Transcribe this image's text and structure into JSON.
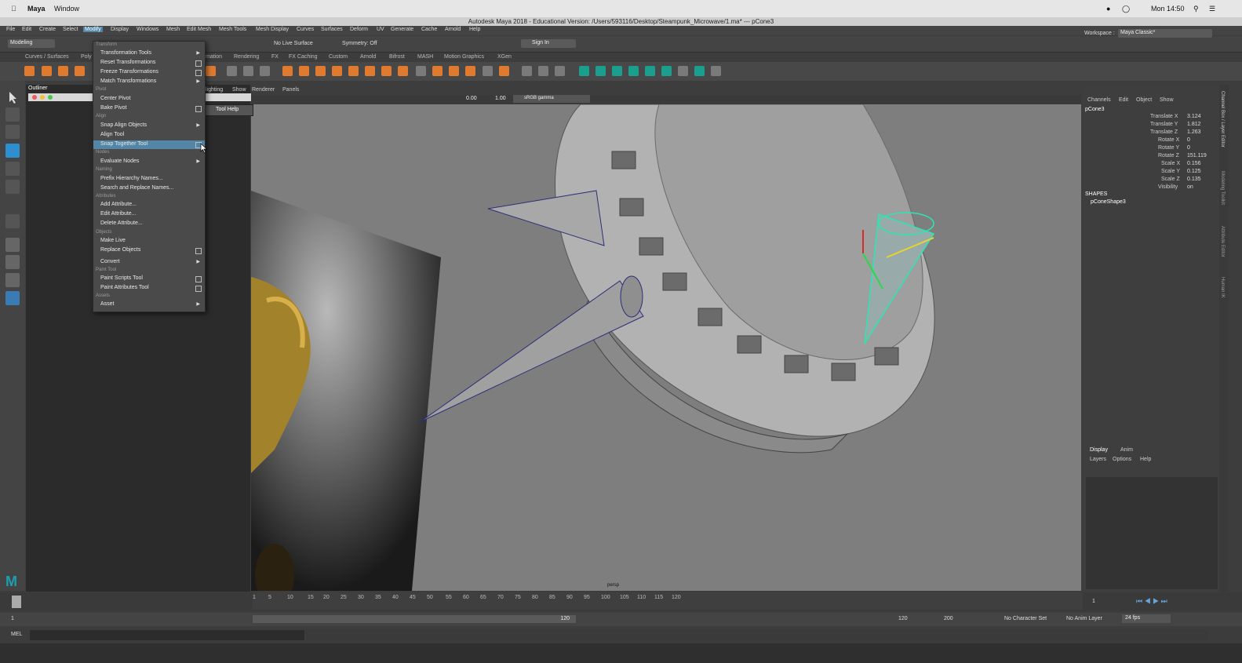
{
  "mac": {
    "app": "Maya",
    "window": "Window",
    "clock": "Mon 14:50"
  },
  "title": "Autodesk Maya 2018 - Educational Version: /Users/593116/Desktop/Steampunk_Microwave/1.ma*  ---  pCone3",
  "menubar": [
    "File",
    "Edit",
    "Create",
    "Select",
    "Modify",
    "Display",
    "Windows",
    "Mesh",
    "Edit Mesh",
    "Mesh Tools",
    "Mesh Display",
    "Curves",
    "Surfaces",
    "Deform",
    "UV",
    "Generate",
    "Cache",
    "Arnold",
    "Help"
  ],
  "status": {
    "mode": "Modeling",
    "live_surface": "No Live Surface",
    "symmetry": "Symmetry: Off",
    "sign_in": "Sign In",
    "workspace_label": "Workspace :",
    "workspace_value": "Maya Classic*"
  },
  "shelf_tabs": [
    "Curves / Surfaces",
    "Poly",
    "mation",
    "Rendering",
    "FX",
    "FX Caching",
    "Custom",
    "Arnold",
    "Bifrost",
    "MASH",
    "Motion Graphics",
    "XGen"
  ],
  "outliner": {
    "title": "Outliner"
  },
  "panel_menu": [
    "lighting",
    "Show",
    "Renderer",
    "Panels"
  ],
  "viewport": {
    "exposure": "0.00",
    "gamma": "1.00",
    "color_space": "sRGB gamma",
    "camera": "persp"
  },
  "modify_menu": {
    "transform_header": "Transform",
    "transformation_tools": "Transformation Tools",
    "reset_transformations": "Reset Transformations",
    "freeze_transformations": "Freeze Transformations",
    "match_transformations": "Match Transformations",
    "pivot_header": "Pivot",
    "center_pivot": "Center Pivot",
    "bake_pivot": "Bake Pivot",
    "align_header": "Align",
    "snap_align_objects": "Snap Align Objects",
    "align_tool": "Align Tool",
    "snap_together_tool": "Snap Together Tool",
    "nodes_header": "Nodes",
    "evaluate_nodes": "Evaluate Nodes",
    "naming_header": "Naming",
    "prefix_hierarchy_names": "Prefix Hierarchy Names...",
    "search_replace_names": "Search and Replace Names...",
    "attributes_header": "Attributes",
    "add_attribute": "Add Attribute...",
    "edit_attribute": "Edit Attribute...",
    "delete_attribute": "Delete Attribute...",
    "objects_header": "Objects",
    "make_live": "Make Live",
    "replace_objects": "Replace Objects",
    "convert": "Convert",
    "paint_tool_header": "Paint Tool",
    "paint_scripts_tool": "Paint Scripts Tool",
    "paint_attributes_tool": "Paint Attributes Tool",
    "assets_header": "Assets",
    "asset": "Asset",
    "tool_help": "Tool Help"
  },
  "channel_box": {
    "menu": [
      "Channels",
      "Edit",
      "Object",
      "Show"
    ],
    "object": "pCone3",
    "attrs": [
      {
        "name": "Translate X",
        "value": "3.124"
      },
      {
        "name": "Translate Y",
        "value": "1.812"
      },
      {
        "name": "Translate Z",
        "value": "1.263"
      },
      {
        "name": "Rotate X",
        "value": "0"
      },
      {
        "name": "Rotate Y",
        "value": "0"
      },
      {
        "name": "Rotate Z",
        "value": "151.119"
      },
      {
        "name": "Scale X",
        "value": "0.156"
      },
      {
        "name": "Scale Y",
        "value": "0.125"
      },
      {
        "name": "Scale Z",
        "value": "0.135"
      },
      {
        "name": "Visibility",
        "value": "on"
      }
    ],
    "shapes_label": "SHAPES",
    "shape_name": "pConeShape3"
  },
  "side_tabs": [
    "Channel Box / Layer Editor",
    "Modeling Toolkit",
    "Attribute Editor",
    "Human IK"
  ],
  "layer_editor": {
    "tabs": [
      "Display",
      "Anim"
    ],
    "menu": [
      "Layers",
      "Options",
      "Help"
    ]
  },
  "timeline": {
    "ticks": [
      "1",
      "",
      "5",
      "10",
      "15",
      "20",
      "25",
      "30",
      "35",
      "40",
      "45",
      "50",
      "55",
      "60",
      "65",
      "70",
      "75",
      "80",
      "85",
      "90",
      "95",
      "100",
      "105",
      "110",
      "115",
      "120"
    ],
    "current_frame": "1"
  },
  "range": {
    "start": "1",
    "end_inner": "120",
    "end_outer": "120",
    "max": "200",
    "character_set": "No Character Set",
    "anim_layer": "No Anim Layer",
    "fps": "24 fps"
  },
  "cmd": {
    "label": "MEL"
  }
}
